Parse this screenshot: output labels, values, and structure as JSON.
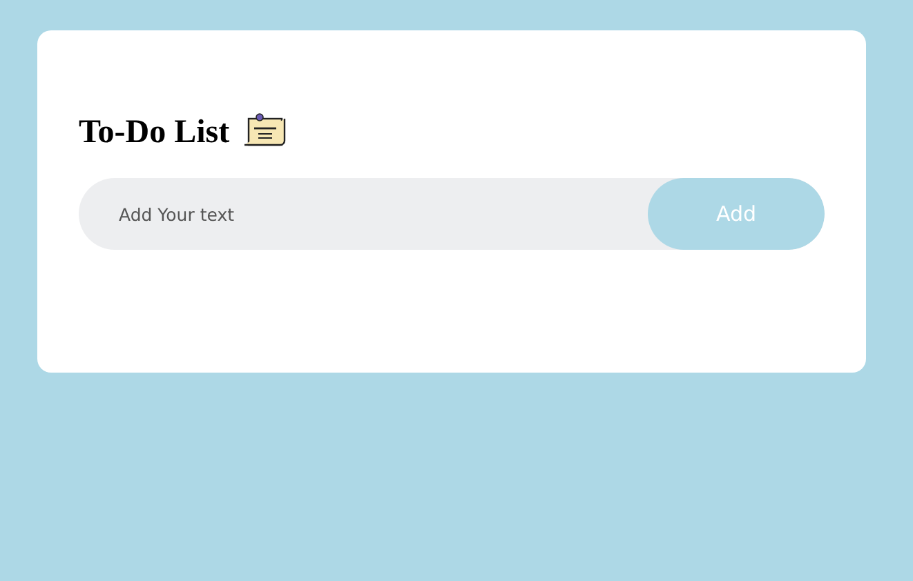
{
  "title": "To-Do List",
  "input": {
    "placeholder": "Add Your text"
  },
  "add_button": "Add"
}
